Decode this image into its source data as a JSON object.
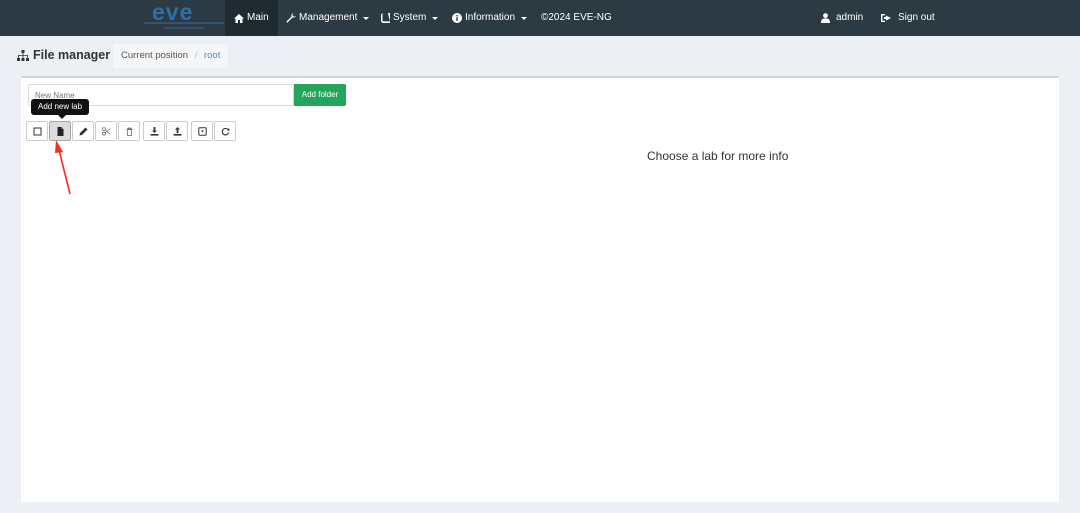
{
  "app": {
    "logo": "eve",
    "accent": "#2c3a44",
    "brand_color": "#2f6ea6"
  },
  "nav": {
    "main": "Main",
    "management": "Management",
    "system": "System",
    "information": "Information",
    "copyright": "©2024 EVE-NG",
    "user": "admin",
    "signout": "Sign out"
  },
  "page": {
    "title": "File manager",
    "breadcrumb_label": "Current position",
    "breadcrumb_sep": "/",
    "breadcrumb_current": "root"
  },
  "folder": {
    "placeholder": "New Name",
    "add_button": "Add folder",
    "button_color": "#25a55b"
  },
  "toolbar": {
    "tooltip": "Add new lab",
    "buttons": [
      "checkbox-icon",
      "new-lab-icon",
      "edit-icon",
      "cut-icon",
      "delete-icon",
      "download-icon",
      "upload-icon",
      "export-icon",
      "refresh-icon"
    ]
  },
  "info": {
    "message": "Choose a lab for more info"
  },
  "annotation": {
    "arrow_color": "#ff2a1a"
  }
}
